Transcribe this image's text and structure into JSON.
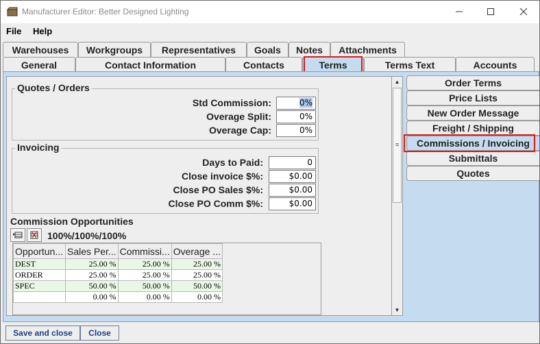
{
  "window": {
    "title": "Manufacturer Editor: Better Designed Lighting",
    "minimize_icon": "minimize-icon",
    "maximize_icon": "maximize-icon",
    "close_icon": "close-icon"
  },
  "menu": {
    "file": "File",
    "help": "Help"
  },
  "tabs_row1": [
    "Warehouses",
    "Workgroups",
    "Representatives",
    "Goals",
    "Notes",
    "Attachments"
  ],
  "tabs_row2": [
    "General",
    "Contact Information",
    "Contacts",
    "Terms",
    "Terms Text",
    "Accounts"
  ],
  "active_tab": "Terms",
  "quotes_orders": {
    "legend": "Quotes / Orders",
    "std_commission_label": "Std Commission:",
    "std_commission_value": "0%",
    "overage_split_label": "Overage Split:",
    "overage_split_value": "0%",
    "overage_cap_label": "Overage Cap:",
    "overage_cap_value": "0%"
  },
  "invoicing": {
    "legend": "Invoicing",
    "days_to_paid_label": "Days to Paid:",
    "days_to_paid_value": "0",
    "close_invoice_label": "Close invoice $%:",
    "close_invoice_value": "$0.00",
    "close_po_sales_label": "Close PO Sales $%:",
    "close_po_sales_value": "$0.00",
    "close_po_comm_label": "Close PO Comm $%:",
    "close_po_comm_value": "$0.00"
  },
  "commission_opportunities": {
    "title": "Commission Opportunities",
    "summary": "100%/100%/100%",
    "columns": [
      "Opportun...",
      "Sales Per...",
      "Commissi...",
      "Overage ..."
    ],
    "rows": [
      {
        "name": "DEST",
        "sales": "25.00 %",
        "commission": "25.00 %",
        "overage": "25.00 %"
      },
      {
        "name": "ORDER",
        "sales": "25.00 %",
        "commission": "25.00 %",
        "overage": "25.00 %"
      },
      {
        "name": "SPEC",
        "sales": "50.00 %",
        "commission": "50.00 %",
        "overage": "50.00 %"
      },
      {
        "name": "",
        "sales": "0.00 %",
        "commission": "0.00 %",
        "overage": "0.00 %"
      }
    ]
  },
  "side_tabs": [
    "Order Terms",
    "Price Lists",
    "New Order Message",
    "Freight / Shipping",
    "Commissions / Invoicing",
    "Submittals",
    "Quotes"
  ],
  "active_side_tab": "Commissions / Invoicing",
  "buttons": {
    "save_and_close": "Save and close",
    "close": "Close"
  },
  "colors": {
    "selected_background": "#c5dbef",
    "highlight_border": "#e01818",
    "alt_row": "#e9f8e4",
    "button_text": "#1c3f8c"
  }
}
